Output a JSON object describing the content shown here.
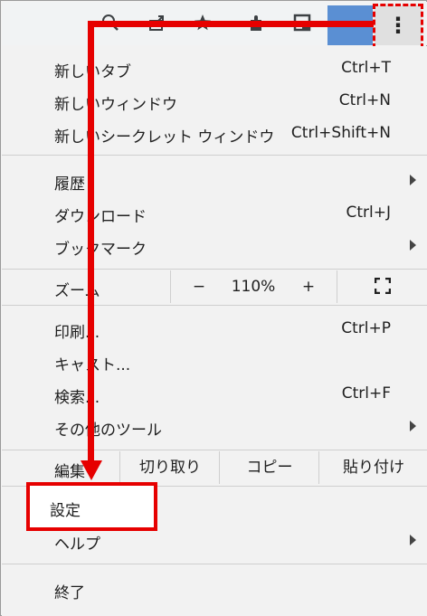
{
  "toolbar": {
    "icons": [
      "zoom-icon",
      "share-icon",
      "bookmark-star-icon",
      "extensions-icon",
      "reading-list-icon",
      "menu-kebab-icon"
    ],
    "kebab_glyph": "⋮"
  },
  "menu": {
    "new_tab": {
      "label": "新しいタブ",
      "shortcut": "Ctrl+T"
    },
    "new_window": {
      "label": "新しいウィンドウ",
      "shortcut": "Ctrl+N"
    },
    "new_incognito": {
      "label": "新しいシークレット ウィンドウ",
      "shortcut": "Ctrl+Shift+N"
    },
    "history": {
      "label": "履歴"
    },
    "downloads": {
      "label": "ダウンロード",
      "shortcut": "Ctrl+J"
    },
    "bookmarks": {
      "label": "ブックマーク"
    },
    "zoom": {
      "label": "ズーム",
      "minus": "−",
      "level": "110%",
      "plus": "+"
    },
    "print": {
      "label": "印刷...",
      "shortcut": "Ctrl+P"
    },
    "cast": {
      "label": "キャスト..."
    },
    "find": {
      "label": "検索...",
      "shortcut": "Ctrl+F"
    },
    "more_tools": {
      "label": "その他のツール"
    },
    "edit": {
      "label": "編集",
      "cut": "切り取り",
      "copy": "コピー",
      "paste": "貼り付け"
    },
    "settings": {
      "label": "設定"
    },
    "help": {
      "label": "ヘルプ"
    },
    "exit": {
      "label": "終了"
    }
  },
  "colors": {
    "highlight": "#e60000",
    "profile": "#5a8fd3"
  }
}
